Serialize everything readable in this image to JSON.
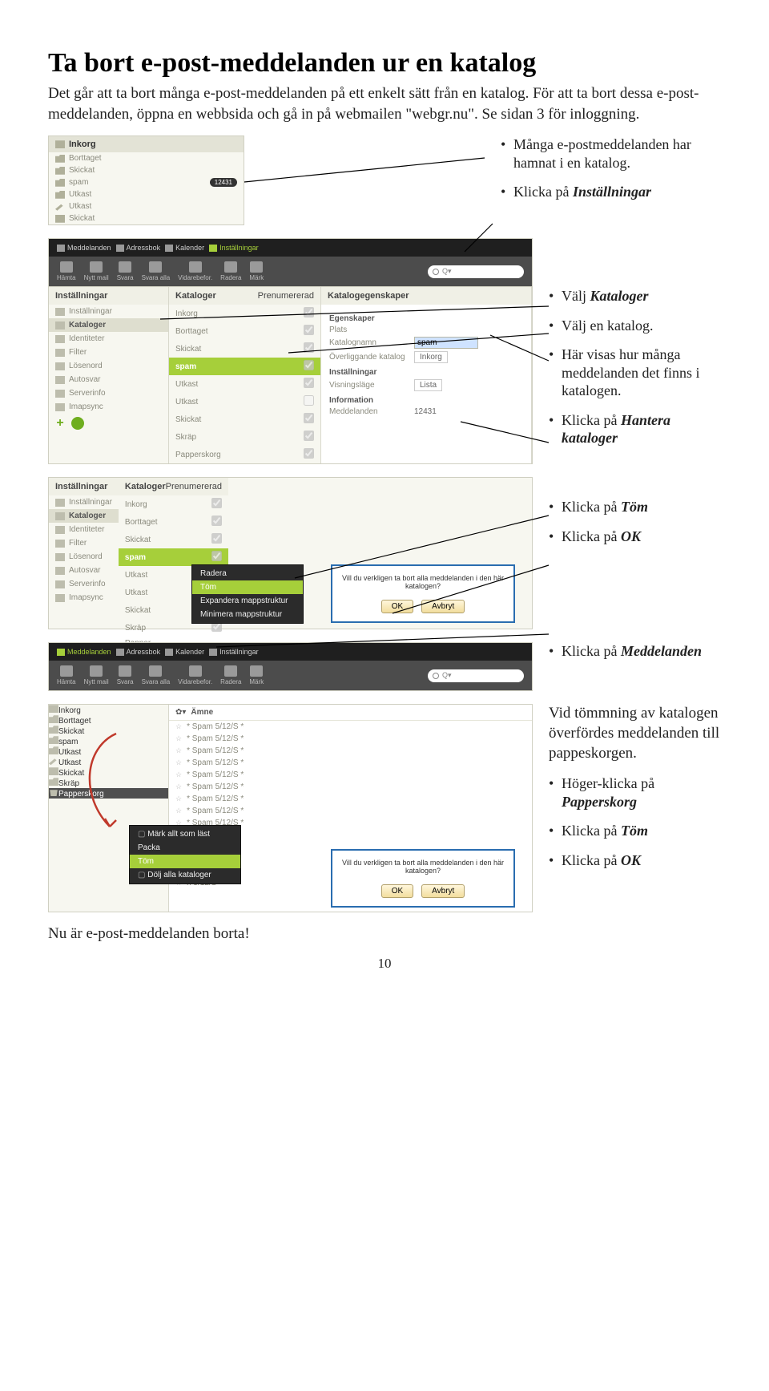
{
  "title": "Ta bort e-post-meddelanden ur en katalog",
  "intro": "Det går att ta bort många e-post-meddelanden på ett enkelt sätt från en katalog. För att ta bort dessa e-post-meddelanden, öppna en webbsida och gå in på webmailen \"webgr.nu\". Se sidan 3 för inloggning.",
  "bullets": {
    "a1": "Många e-postmeddelanden har hamnat i en katalog.",
    "a2_pre": "Klicka på",
    "a2_em": "Inställningar",
    "b1_pre": "Välj",
    "b1_em": "Kataloger",
    "b2": "Välj en katalog.",
    "b3": "Här visas hur många meddelanden det finns i katalogen.",
    "b4_pre": "Klicka på",
    "b4_em": "Hantera kataloger",
    "c1_pre": "Klicka på",
    "c1_em": "Töm",
    "c2_pre": "Klicka på",
    "c2_em": "OK",
    "d1_pre": "Klicka på",
    "d1_em": "Meddelanden",
    "e_intro": "Vid tömmning av katalogen överfördes meddelanden till pappeskorgen.",
    "e1_pre": "Höger-klicka på",
    "e1_em": "Papperskorg",
    "e2_pre": "Klicka på",
    "e2_em": "Töm",
    "e3_pre": "Klicka på",
    "e3_em": "OK"
  },
  "sidebar1": {
    "head": "Inkorg",
    "items": [
      {
        "label": "Borttaget"
      },
      {
        "label": "Skickat"
      },
      {
        "label": "spam",
        "badge": "12431"
      },
      {
        "label": "Utkast"
      },
      {
        "label": "Utkast"
      },
      {
        "label": "Skickat"
      }
    ]
  },
  "topbar": {
    "t1": "Meddelanden",
    "t2": "Adressbok",
    "t3": "Kalender",
    "t4": "Inställningar"
  },
  "actbar": {
    "a1": "Hämta",
    "a2": "Nytt mail",
    "a3": "Svara",
    "a4": "Svara alla",
    "a5": "Vidarebefor.",
    "a6": "Radera",
    "a7": "Märk",
    "search_ph": "Q"
  },
  "settings": {
    "colA_head": "Inställningar",
    "colA_items": [
      "Inställningar",
      "Kataloger",
      "Identiteter",
      "Filter",
      "Lösenord",
      "Autosvar",
      "Serverinfo",
      "Imapsync"
    ],
    "colB_head": "Kataloger",
    "colB_head2": "Prenumererad",
    "colB_items": [
      "Inkorg",
      "Borttaget",
      "Skickat",
      "spam",
      "Utkast",
      "Utkast",
      "Skickat",
      "Skräp",
      "Papperskorg"
    ],
    "colC_head": "Katalogegenskaper",
    "prop_sec1": "Egenskaper",
    "prop_plats": "Plats",
    "prop_name_lbl": "Katalognamn",
    "prop_name_val": "spam",
    "prop_parent_lbl": "Överliggande katalog",
    "prop_parent_val": "Inkorg",
    "prop_sec2": "Inställningar",
    "prop_view_lbl": "Visningsläge",
    "prop_view_val": "Lista",
    "prop_sec3": "Information",
    "prop_msg_lbl": "Meddelanden",
    "prop_msg_val": "12431"
  },
  "settings2": {
    "colA_items": [
      "Inställningar",
      "Kataloger",
      "Identiteter",
      "Filter",
      "Lösenord",
      "Autosvar",
      "Serverinfo",
      "Imapsync"
    ],
    "colB_items": [
      "Inkorg",
      "Borttaget",
      "Skickat",
      "spam",
      "Utkast",
      "Utkast",
      "Skickat",
      "Skräp",
      "Papper"
    ],
    "ctx": [
      "Radera",
      "Töm",
      "Expandera mappstruktur",
      "Minimera mappstruktur"
    ],
    "q": "Vill du verkligen ta bort alla meddelanden i den här katalogen?",
    "ok": "OK",
    "cancel": "Avbryt"
  },
  "maillist": {
    "folders": [
      "Inkorg",
      "Borttaget",
      "Skickat",
      "spam",
      "Utkast",
      "Utkast",
      "Skickat",
      "Skräp",
      "Papperskorg"
    ],
    "subj_head": "Ämne",
    "subjects": [
      "* Spam 5/12/S *",
      "* Spam 5/12/S *",
      "* Spam 5/12/S *",
      "* Spam 5/12/S *",
      "* Spam 5/12/S *",
      "* Spam 5/12/S *",
      "* Spam 5/12/S *",
      "* Spam 5/12/S *",
      "* Spam 5/12/S *",
      "n 5/12/S *",
      "n 5/12/S *",
      "n 5/12/S *",
      "n 5/12/S *",
      "n 5/12/S *"
    ],
    "ctx": [
      "Märk allt som läst",
      "Packa",
      "Töm",
      "Dölj alla kataloger"
    ],
    "q": "Vill du verkligen ta bort alla meddelanden i den här katalogen?",
    "ok": "OK",
    "cancel": "Avbryt"
  },
  "closing": "Nu är e-post-meddelanden borta!",
  "pagenum": "10"
}
